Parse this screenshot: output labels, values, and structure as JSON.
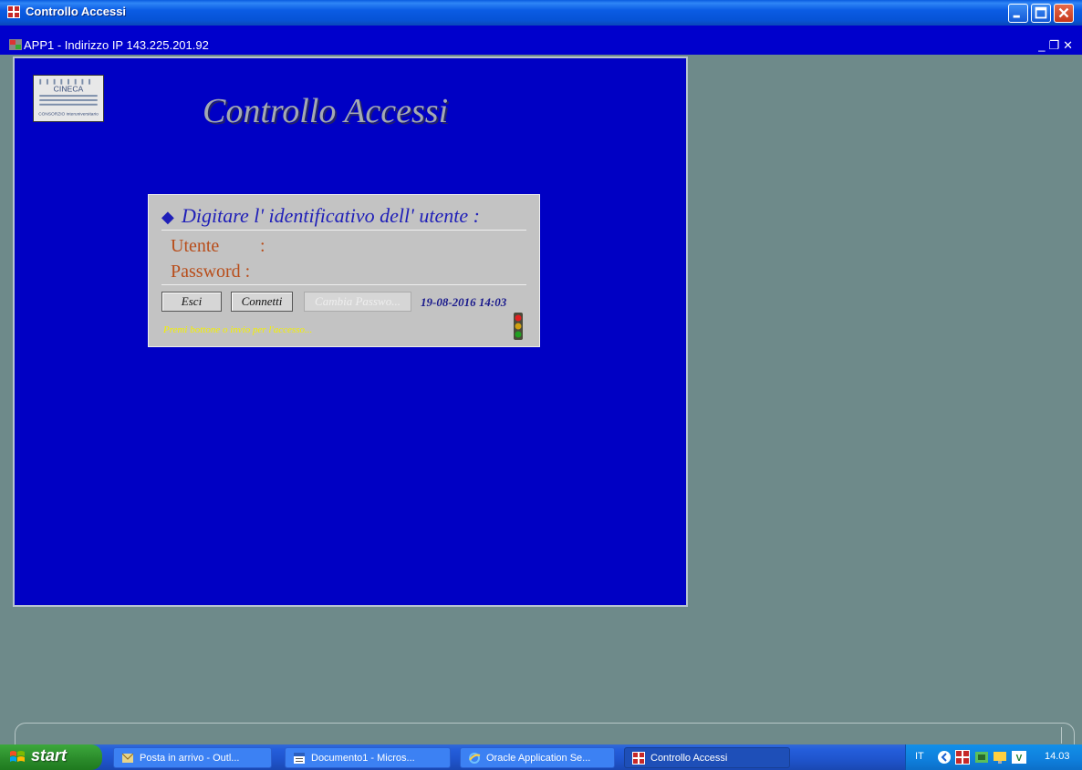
{
  "window": {
    "title": "Controllo Accessi"
  },
  "mdi": {
    "title": "APP1 - Indirizzo IP 143.225.201.92"
  },
  "app": {
    "heading": "Controllo Accessi",
    "logo_text_top": "CINECA",
    "logo_text_bottom": "CONSORZIO interuniversitario"
  },
  "login": {
    "prompt": "Digitare l' identificativo dell' utente :",
    "user_label": "Utente",
    "user_colon": ":",
    "password_label": "Password :",
    "buttons": {
      "esci": "Esci",
      "connetti": "Connetti",
      "cambia": "Cambia Passwo..."
    },
    "datetime": "19-08-2016 14:03",
    "hint": "Premi bottone o invio per l'accesso..."
  },
  "taskbar": {
    "start_label": "start",
    "tasks": [
      {
        "label": "Posta in arrivo - Outl..."
      },
      {
        "label": "Documento1 - Micros..."
      },
      {
        "label": "Oracle Application Se..."
      },
      {
        "label": "Controllo Accessi"
      }
    ],
    "language": "IT",
    "clock": "14.03"
  }
}
